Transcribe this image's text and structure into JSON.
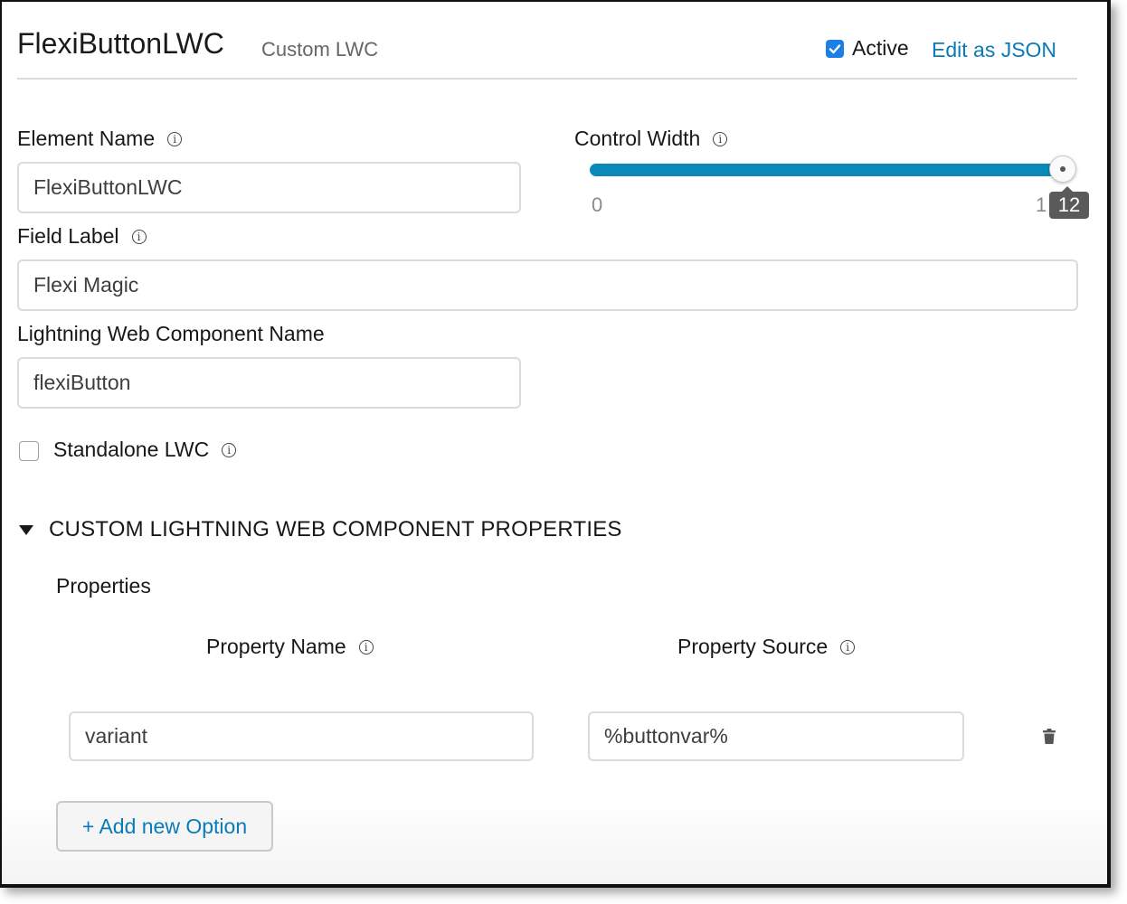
{
  "header": {
    "title": "FlexiButtonLWC",
    "subtitle": "Custom LWC",
    "active_label": "Active",
    "active_checked": true,
    "edit_json_label": "Edit as JSON"
  },
  "fields": {
    "element_name": {
      "label": "Element Name",
      "value": "FlexiButtonLWC"
    },
    "control_width": {
      "label": "Control Width",
      "min_label": "0",
      "max_label": "1",
      "value_label": "12",
      "value": 12,
      "min": 0,
      "max": 12
    },
    "field_label": {
      "label": "Field Label",
      "value": "Flexi Magic"
    },
    "lwc_name": {
      "label": "Lightning Web Component Name",
      "value": "flexiButton"
    },
    "standalone": {
      "label": "Standalone LWC",
      "checked": false
    }
  },
  "section": {
    "title": "CUSTOM LIGHTNING WEB COMPONENT PROPERTIES",
    "properties_label": "Properties",
    "columns": {
      "name": "Property Name",
      "source": "Property Source"
    },
    "rows": [
      {
        "name": "variant",
        "source": "%buttonvar%"
      }
    ],
    "add_label": "+ Add new Option"
  },
  "colors": {
    "accent": "#0a7bb8",
    "checkbox": "#1b7fe6",
    "slider": "#0a89b8"
  },
  "icons": {
    "info": "info-circle-icon",
    "check": "checkmark-icon",
    "toggle": "triangle-down-icon",
    "delete": "trash-icon"
  }
}
